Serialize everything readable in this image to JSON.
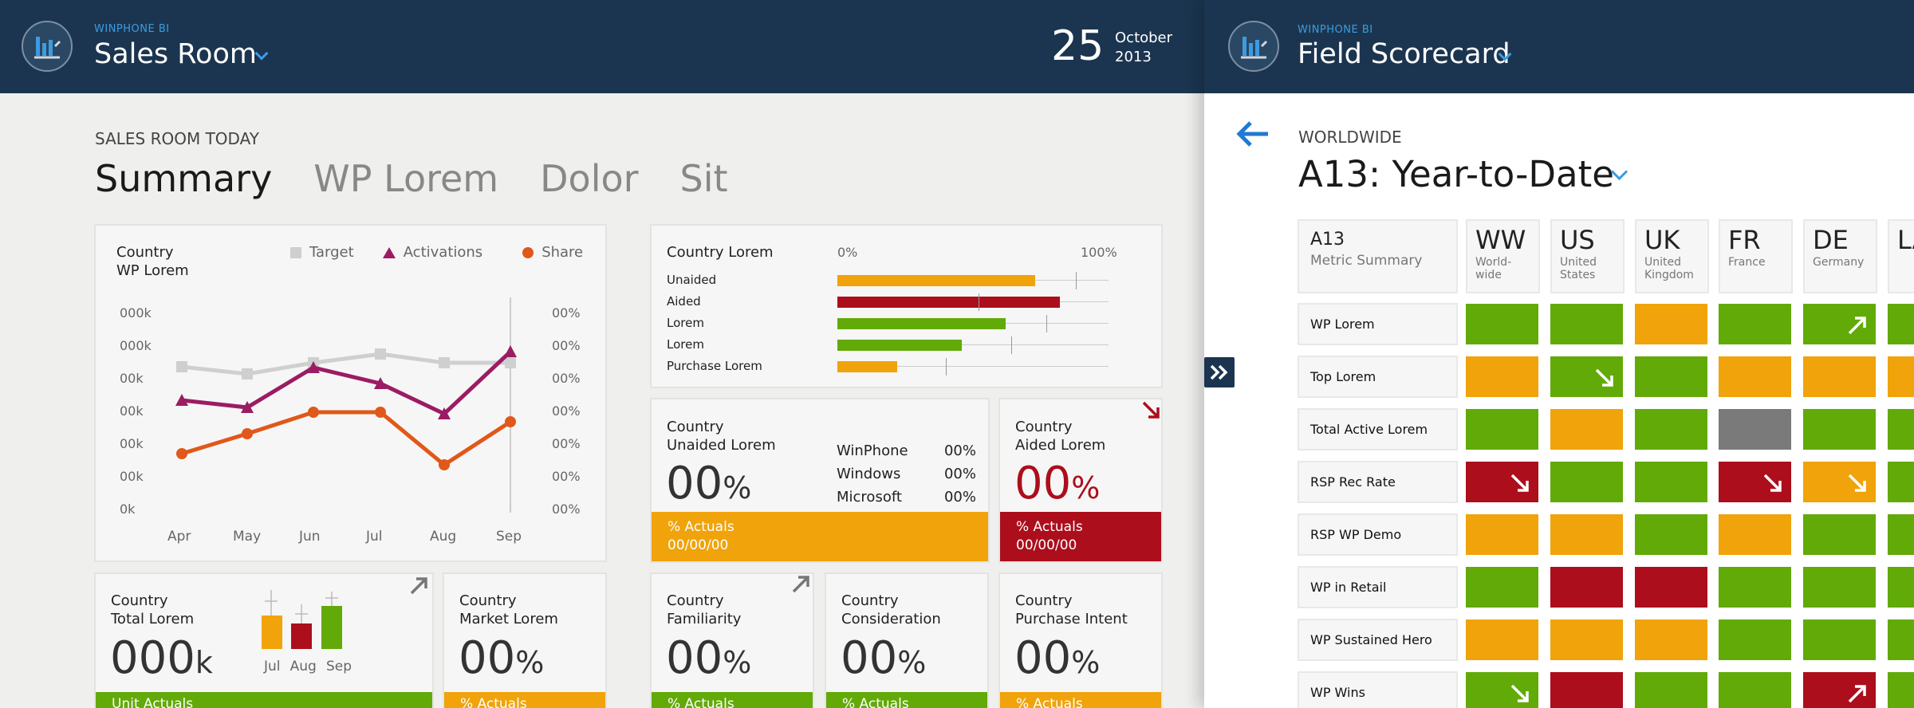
{
  "left_app": {
    "brand": "WINPHONE BI",
    "title": "Sales Room",
    "date_day": "25",
    "date_month": "October",
    "date_year": "2013",
    "section_label": "SALES ROOM TODAY",
    "tabs": [
      {
        "label": "Summary",
        "active": true
      },
      {
        "label": "WP Lorem",
        "active": false
      },
      {
        "label": "Dolor",
        "active": false
      },
      {
        "label": "Sit",
        "active": false
      }
    ],
    "line_card": {
      "title1": "Country",
      "title2": "WP Lorem",
      "legend": [
        "Target",
        "Activations",
        "Share"
      ],
      "left_ticks": [
        "000k",
        "000k",
        "00k",
        "00k",
        "00k",
        "00k",
        "0k"
      ],
      "right_ticks": [
        "00%",
        "00%",
        "00%",
        "00%",
        "00%",
        "00%",
        "00%"
      ],
      "months": [
        "Apr",
        "May",
        "Jun",
        "Jul",
        "Aug",
        "Sep"
      ]
    },
    "bar_card": {
      "title": "Country Lorem",
      "axis_min": "0%",
      "axis_max": "100%",
      "rows": [
        {
          "label": "Unaided",
          "value": 0.73,
          "target": 0.88,
          "color": "#f0a30a"
        },
        {
          "label": "Aided",
          "value": 0.82,
          "target": 0.52,
          "color": "#ac0e1c"
        },
        {
          "label": "Lorem",
          "value": 0.62,
          "target": 0.77,
          "color": "#62aa08"
        },
        {
          "label": "Lorem",
          "value": 0.46,
          "target": 0.64,
          "color": "#62aa08"
        },
        {
          "label": "Purchase Lorem",
          "value": 0.22,
          "target": 0.4,
          "color": "#f0a30a"
        }
      ]
    },
    "unaided_card": {
      "title1": "Country",
      "title2": "Unaided Lorem",
      "value": "00",
      "unit": "%",
      "brands": [
        {
          "name": "WinPhone",
          "value": "00%"
        },
        {
          "name": "Windows",
          "value": "00%"
        },
        {
          "name": "Microsoft",
          "value": "00%"
        }
      ],
      "foot1": "% Actuals",
      "foot2": "00/00/00"
    },
    "aided_card": {
      "title1": "Country",
      "title2": "Aided Lorem",
      "value": "00",
      "unit": "%",
      "foot1": "% Actuals",
      "foot2": "00/00/00"
    },
    "total_card": {
      "title1": "Country",
      "title2": "Total Lorem",
      "value": "000",
      "unit": "k",
      "months": [
        "Jul",
        "Aug",
        "Sep"
      ],
      "foot": "Unit Actuals"
    },
    "small_cards": [
      {
        "title1": "Country",
        "title2": "Market Lorem",
        "value": "00",
        "unit": "%",
        "foot": "% Actuals",
        "foot_color": "#f0a30a"
      },
      {
        "title1": "Country",
        "title2": "Familiarity",
        "value": "00",
        "unit": "%",
        "foot": "% Actuals",
        "foot_color": "#62aa08"
      },
      {
        "title1": "Country",
        "title2": "Consideration",
        "value": "00",
        "unit": "%",
        "foot": "% Actuals",
        "foot_color": "#62aa08"
      },
      {
        "title1": "Country",
        "title2": "Purchase Intent",
        "value": "00",
        "unit": "%",
        "foot": "% Actuals",
        "foot_color": "#f0a30a"
      }
    ]
  },
  "right_app": {
    "brand": "WINPHONE BI",
    "title": "Field Scorecard",
    "region": "WORLDWIDE",
    "period": "A13: Year-to-Date",
    "metric_header_code": "A13",
    "metric_header_label": "Metric Summary",
    "columns": [
      {
        "code": "WW",
        "name": "World-wide"
      },
      {
        "code": "US",
        "name": "United States"
      },
      {
        "code": "UK",
        "name": "United Kingdom"
      },
      {
        "code": "FR",
        "name": "France"
      },
      {
        "code": "DE",
        "name": "Germany"
      },
      {
        "code": "LA",
        "name": ""
      }
    ],
    "rows": [
      {
        "label": "WP Lorem",
        "cells": [
          "G",
          "G",
          "O",
          "G",
          "G:up",
          "G"
        ]
      },
      {
        "label": "Top Lorem",
        "cells": [
          "O",
          "G:down",
          "G",
          "O",
          "O",
          "O"
        ]
      },
      {
        "label": "Total Active Lorem",
        "cells": [
          "G",
          "O",
          "G",
          "X",
          "G",
          "G"
        ]
      },
      {
        "label": "RSP Rec Rate",
        "cells": [
          "R:down",
          "G",
          "G",
          "R:down",
          "O:down",
          "G"
        ]
      },
      {
        "label": "RSP WP Demo",
        "cells": [
          "O",
          "O",
          "G",
          "O",
          "G",
          "G"
        ]
      },
      {
        "label": "WP in Retail",
        "cells": [
          "G",
          "R",
          "R",
          "G",
          "G",
          "G"
        ]
      },
      {
        "label": "WP Sustained Hero",
        "cells": [
          "O",
          "O",
          "O",
          "G",
          "G",
          "G"
        ]
      },
      {
        "label": "WP Wins",
        "cells": [
          "G:down",
          "R",
          "G",
          "G",
          "R:up",
          "G"
        ]
      }
    ]
  },
  "colors": {
    "header": "#1b3550",
    "accent_blue": "#3d9be0",
    "green": "#62aa08",
    "orange": "#f0a30a",
    "red": "#ac0e1c",
    "gray": "#7a7a7a",
    "purple": "#9b1c63",
    "share_orange": "#e0581a",
    "target_gray": "#cfcfcf"
  },
  "icons": {
    "logo": "bar-chart-logo-icon",
    "back": "back-arrow-icon",
    "expand": "double-chevron-right-icon",
    "trend_up": "arrow-up-right-icon",
    "trend_down": "arrow-down-right-icon"
  }
}
